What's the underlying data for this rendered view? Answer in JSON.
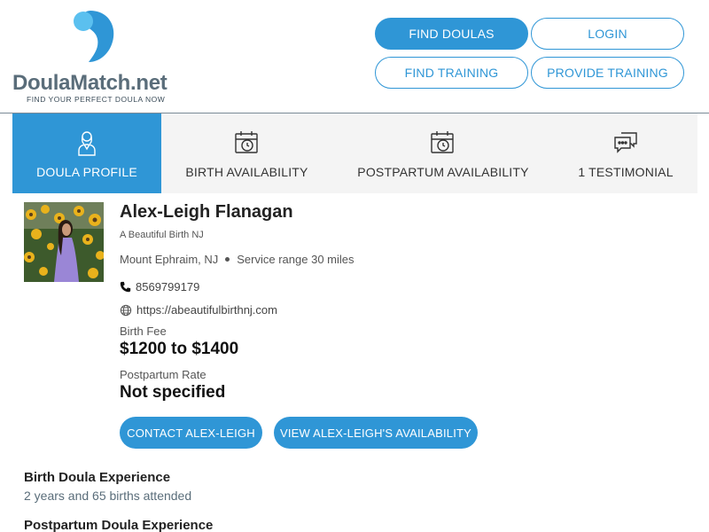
{
  "brand": {
    "name_main": "Doula",
    "name_accent": "Match.net",
    "tagline": "FIND YOUR PERFECT DOULA NOW",
    "colors": {
      "primary": "#2f96d6",
      "logo_text": "#5a6d7a",
      "logo_light": "#5bc0ef"
    }
  },
  "header_nav": {
    "find_doulas": "FIND DOULAS",
    "login": "LOGIN",
    "find_training": "FIND TRAINING",
    "provide_training": "PROVIDE TRAINING"
  },
  "tabs": [
    {
      "label": "DOULA PROFILE",
      "icon": "doula-person-icon",
      "active": true
    },
    {
      "label": "BIRTH AVAILABILITY",
      "icon": "calendar-clock-icon",
      "active": false
    },
    {
      "label": "POSTPARTUM AVAILABILITY",
      "icon": "calendar-clock-icon",
      "active": false
    },
    {
      "label": "1 TESTIMONIAL",
      "icon": "chat-bubbles-icon",
      "active": false
    }
  ],
  "profile": {
    "name": "Alex-Leigh Flanagan",
    "business": "A Beautiful Birth NJ",
    "city": "Mount Ephraim, NJ",
    "service_range": "Service range 30 miles",
    "phone": "8569799179",
    "website": "https://abeautifulbirthnj.com",
    "birth_fee_label": "Birth Fee",
    "birth_fee": "$1200 to $1400",
    "postpartum_label": "Postpartum Rate",
    "postpartum_rate": "Not specified",
    "contact_button": "CONTACT ALEX-LEIGH",
    "availability_button": "VIEW ALEX-LEIGH'S AVAILABILITY"
  },
  "experience": {
    "birth_title": "Birth Doula Experience",
    "birth_detail": "2 years and 65 births attended",
    "postpartum_title": "Postpartum Doula Experience"
  }
}
